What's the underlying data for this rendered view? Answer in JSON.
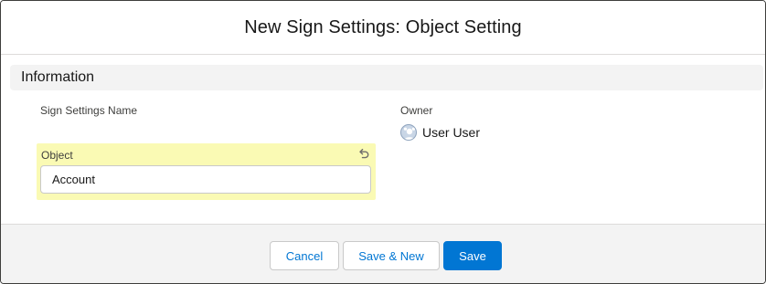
{
  "header": {
    "title": "New Sign Settings: Object Setting"
  },
  "section": {
    "title": "Information"
  },
  "fields": {
    "sign_settings_name_label": "Sign Settings Name",
    "owner_label": "Owner",
    "owner_value": "User User",
    "object_label": "Object",
    "object_value": "Account"
  },
  "footer": {
    "cancel_label": "Cancel",
    "save_new_label": "Save & New",
    "save_label": "Save"
  },
  "icons": {
    "avatar": "user-avatar-icon",
    "undo": "undo-icon"
  },
  "colors": {
    "brand": "#0176d3",
    "highlight": "#fafab4",
    "section_bg": "#f3f3f3"
  }
}
